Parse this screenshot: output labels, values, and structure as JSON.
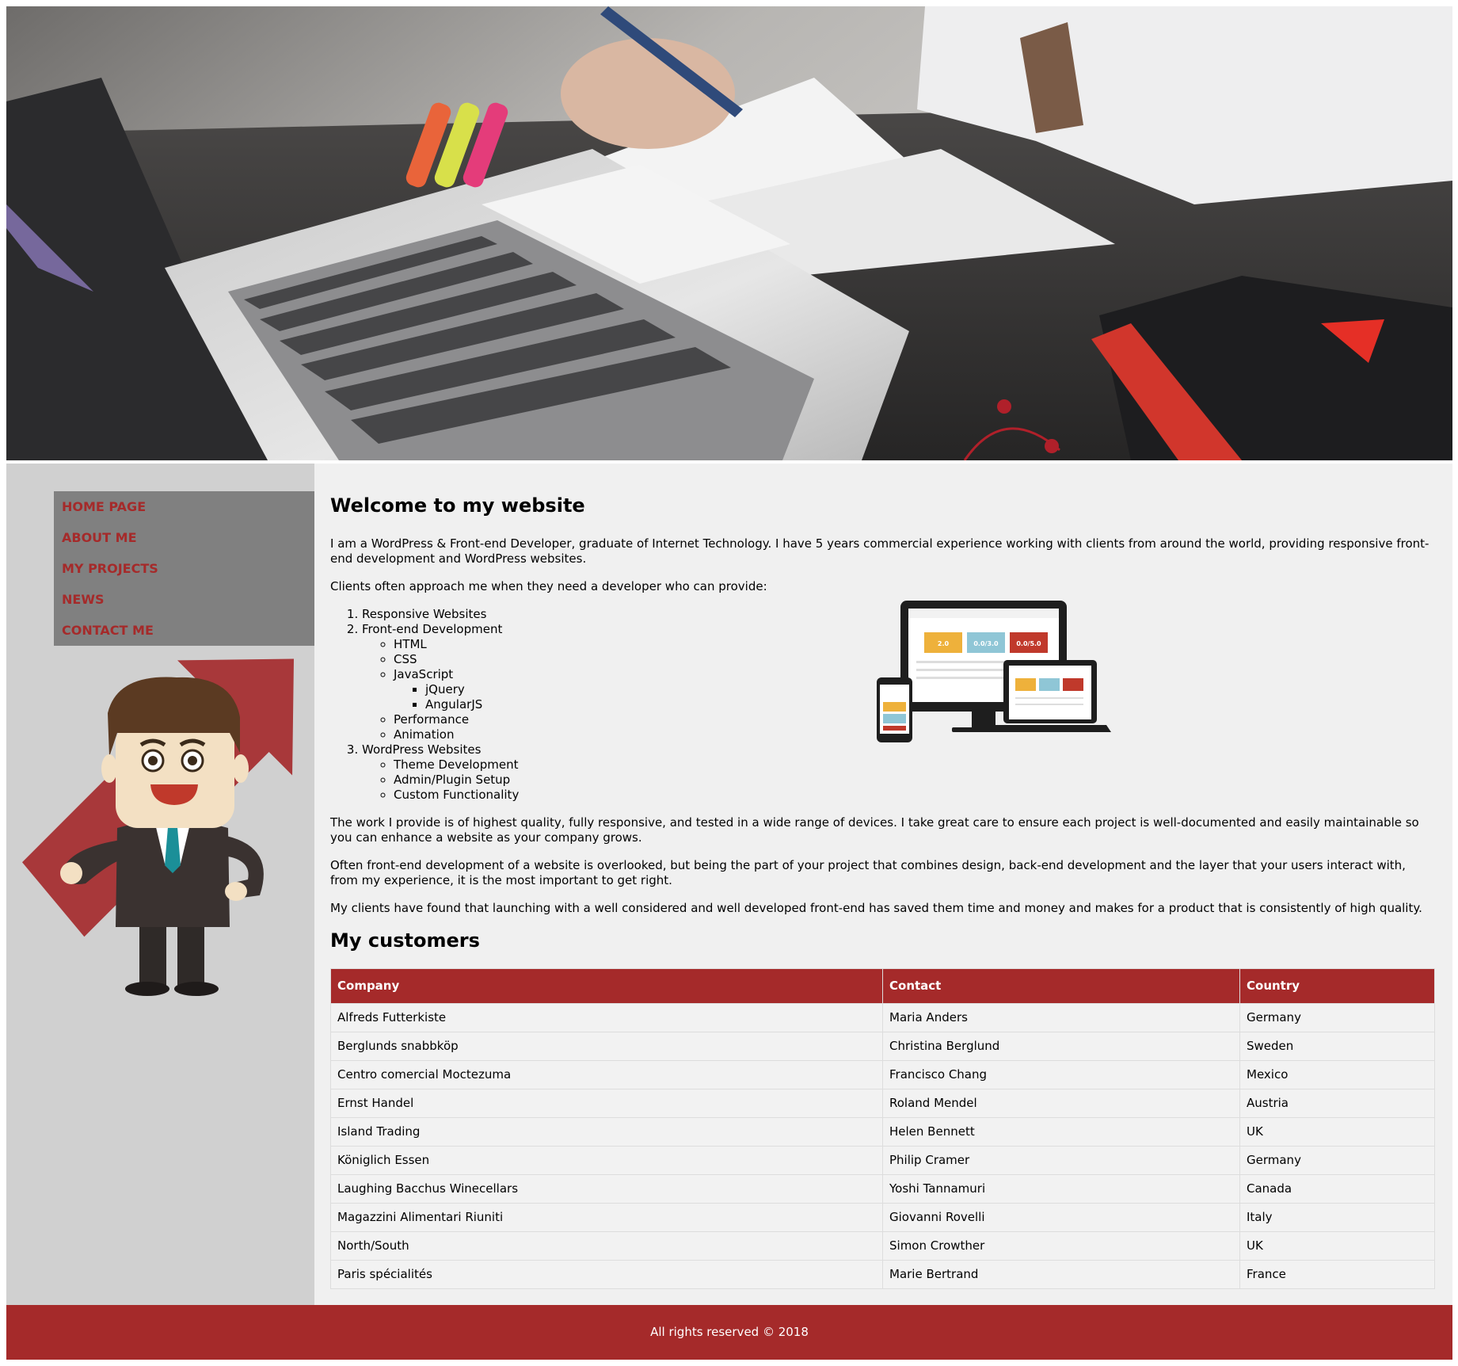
{
  "nav": {
    "items": [
      "Home Page",
      "About Me",
      "My Projects",
      "News",
      "Contact Me"
    ]
  },
  "main": {
    "title": "Welcome to my website",
    "intro": "I am a WordPress & Front-end Developer, graduate of Internet Technology. I have 5 years commercial experience working with clients from around the world, providing responsive front-end development and WordPress websites.",
    "lead": "Clients often approach me when they need a developer who can provide:",
    "services": {
      "responsive": "Responsive Websites",
      "frontend": "Front-end Development",
      "html": "HTML",
      "css": "CSS",
      "javascript": "JavaScript",
      "jquery": "jQuery",
      "angularjs": "AngularJS",
      "performance": "Performance",
      "animation": "Animation",
      "wordpress": "WordPress Websites",
      "theme": "Theme Development",
      "admin": "Admin/Plugin Setup",
      "custom": "Custom Functionality"
    },
    "para1": "The work I provide is of highest quality, fully responsive, and tested in a wide range of devices. I take great care to ensure each project is well-documented and easily maintainable so you can enhance a website as your company grows.",
    "para2": "Often front-end development of a website is overlooked, but being the part of your project that combines design, back-end development and the layer that your users interact with, from my experience, it is the most important to get right.",
    "para3": "My clients have found that launching with a well considered and well developed front-end has saved them time and money and makes for a product that is consistently of high quality.",
    "customers_title": "My customers"
  },
  "devices_screen": {
    "tile1": "2.0",
    "tile2": "0.0/3.0",
    "tile3": "0.0/5.0"
  },
  "table": {
    "headers": [
      "Company",
      "Contact",
      "Country"
    ],
    "rows": [
      [
        "Alfreds Futterkiste",
        "Maria Anders",
        "Germany"
      ],
      [
        "Berglunds snabbköp",
        "Christina Berglund",
        "Sweden"
      ],
      [
        "Centro comercial Moctezuma",
        "Francisco Chang",
        "Mexico"
      ],
      [
        "Ernst Handel",
        "Roland Mendel",
        "Austria"
      ],
      [
        "Island Trading",
        "Helen Bennett",
        "UK"
      ],
      [
        "Königlich Essen",
        "Philip Cramer",
        "Germany"
      ],
      [
        "Laughing Bacchus Winecellars",
        "Yoshi Tannamuri",
        "Canada"
      ],
      [
        "Magazzini Alimentari Riuniti",
        "Giovanni Rovelli",
        "Italy"
      ],
      [
        "North/South",
        "Simon Crowther",
        "UK"
      ],
      [
        "Paris spécialités",
        "Marie Bertrand",
        "France"
      ]
    ]
  },
  "footer": {
    "text": "All rights reserved © 2018"
  },
  "colors": {
    "accent": "#a52a2a",
    "nav_bg": "#808080",
    "sidebar_bg": "#d0d0d0",
    "main_bg": "#f0f0f0"
  }
}
